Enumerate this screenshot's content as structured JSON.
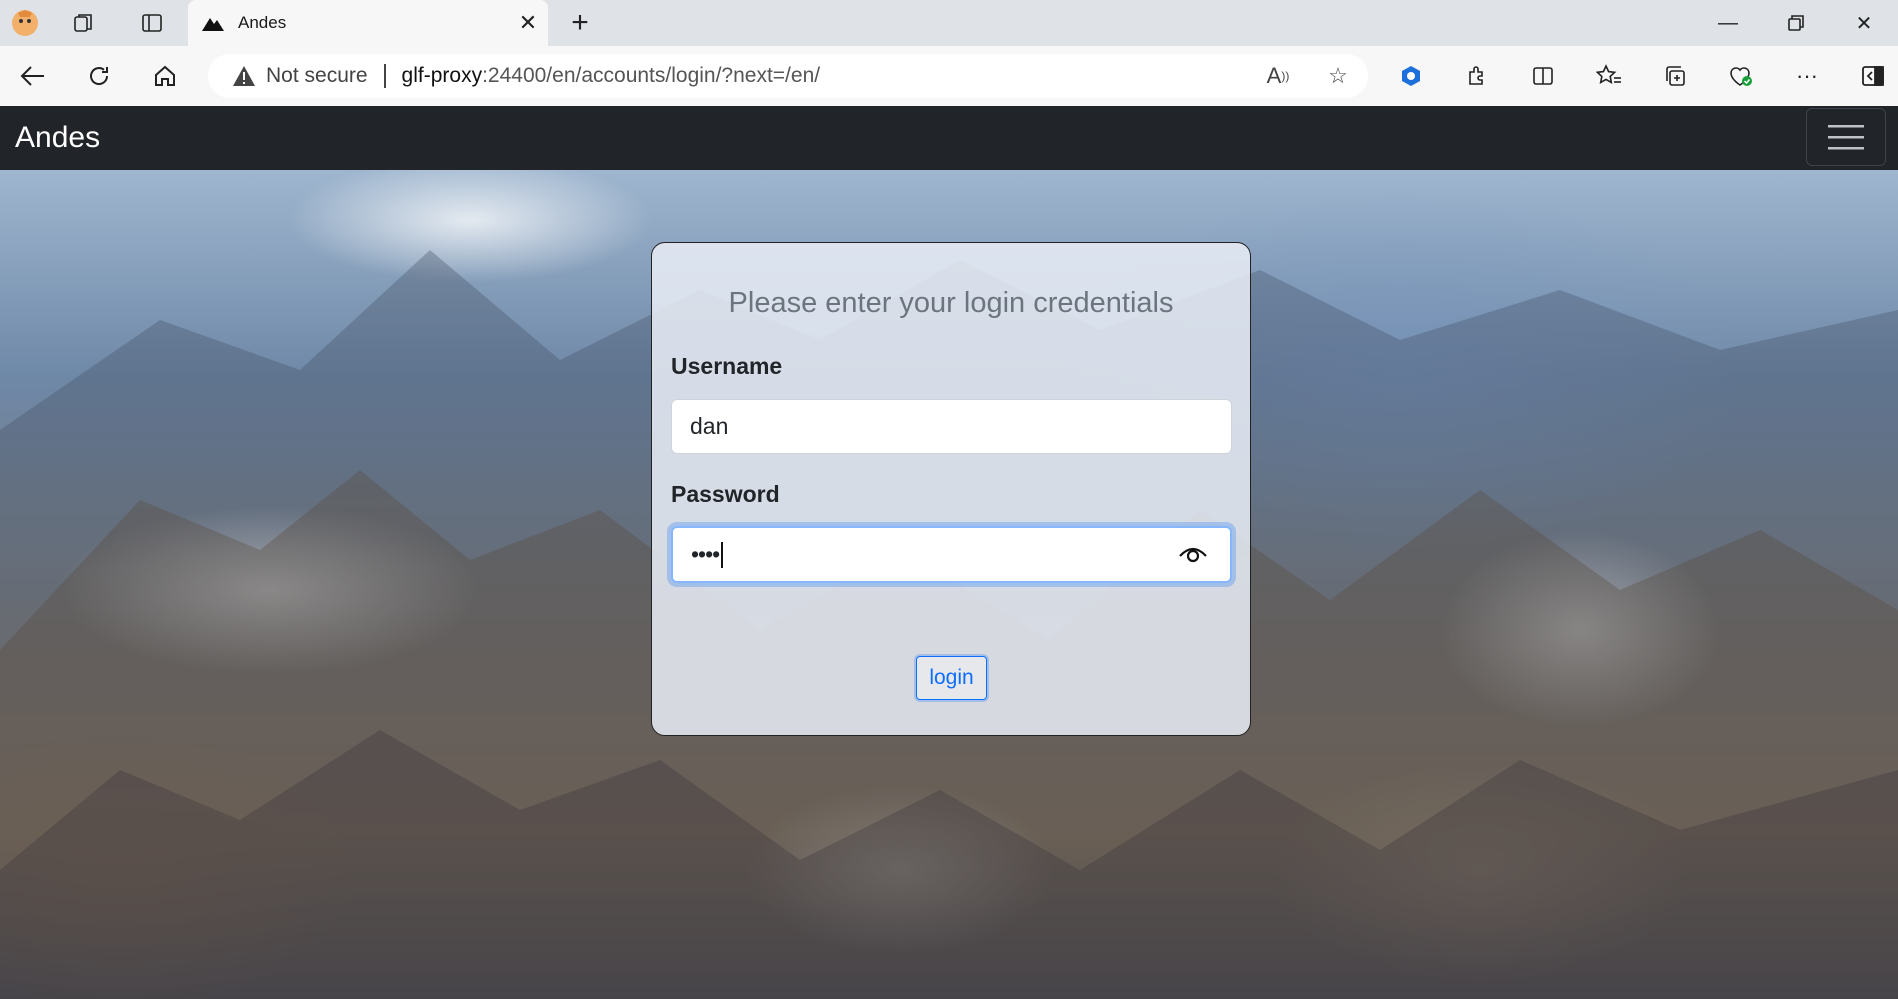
{
  "browser": {
    "tab_title": "Andes",
    "security_label": "Not secure",
    "url_host": "glf-proxy",
    "url_rest": ":24400/en/accounts/login/?next=/en/"
  },
  "navbar": {
    "brand": "Andes"
  },
  "login": {
    "heading": "Please enter your login credentials",
    "username_label": "Username",
    "username_value": "dan",
    "password_label": "Password",
    "password_mask": "••••",
    "submit_label": "login"
  }
}
